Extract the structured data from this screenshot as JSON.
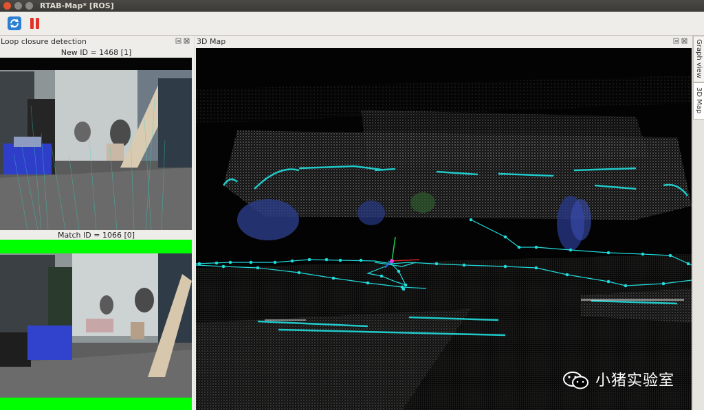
{
  "window": {
    "title": "RTAB-Map* [ROS]",
    "close_color": "#e0542e",
    "minimize_color": "#8a8884",
    "maximize_color": "#8a8884"
  },
  "toolbar": {
    "items": [
      {
        "name": "refresh-button",
        "icon": "refresh-icon",
        "color": "#2a7fd4"
      },
      {
        "name": "pause-button",
        "icon": "pause-icon",
        "color": "#e0342a"
      }
    ]
  },
  "loop_closure_panel": {
    "title": "Loop closure detection",
    "new_id_label": "New ID = 1468 [1]",
    "match_id_label": "Match ID = 1066 [0]",
    "match_bar_color": "#00ff00"
  },
  "map_panel": {
    "title": "3D Map",
    "graph_color": "#22dcdc"
  },
  "side_tabs": [
    {
      "label": "Graph view"
    },
    {
      "label": "3D Map"
    }
  ],
  "watermark": {
    "text": "小猪实验室",
    "icon": "wechat-icon"
  }
}
